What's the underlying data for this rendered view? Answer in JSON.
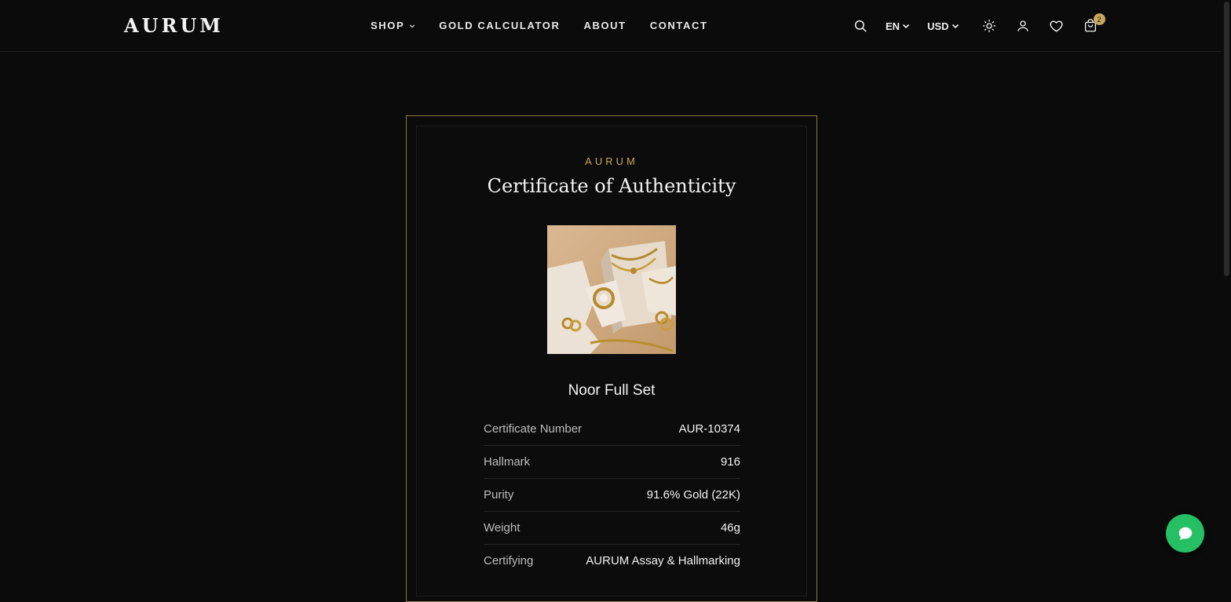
{
  "brand": {
    "logo": "AURUM"
  },
  "nav": {
    "items": [
      {
        "label": "SHOP",
        "dropdown": true
      },
      {
        "label": "GOLD CALCULATOR",
        "dropdown": false
      },
      {
        "label": "ABOUT",
        "dropdown": false
      },
      {
        "label": "CONTACT",
        "dropdown": false
      }
    ]
  },
  "toolbar": {
    "language": "EN",
    "currency": "USD",
    "cart_count": "2",
    "icons": [
      "search-icon",
      "sun-icon",
      "user-icon",
      "heart-icon",
      "shopping-bag-icon"
    ]
  },
  "certificate": {
    "brand": "AURUM",
    "title": "Certificate of Authenticity",
    "product_name": "Noor Full Set",
    "fields": [
      {
        "label": "Certificate Number",
        "value": "AUR-10374"
      },
      {
        "label": "Hallmark",
        "value": "916"
      },
      {
        "label": "Purity",
        "value": "91.6% Gold (22K)"
      },
      {
        "label": "Weight",
        "value": "46g"
      },
      {
        "label": "Certifying",
        "value": "AURUM Assay & Hallmarking"
      }
    ]
  },
  "colors": {
    "background": "#0b0b0b",
    "accent_gold": "#c9a560",
    "chat_green": "#25c063"
  },
  "chat": {
    "icon": "chat-bubble-icon"
  }
}
